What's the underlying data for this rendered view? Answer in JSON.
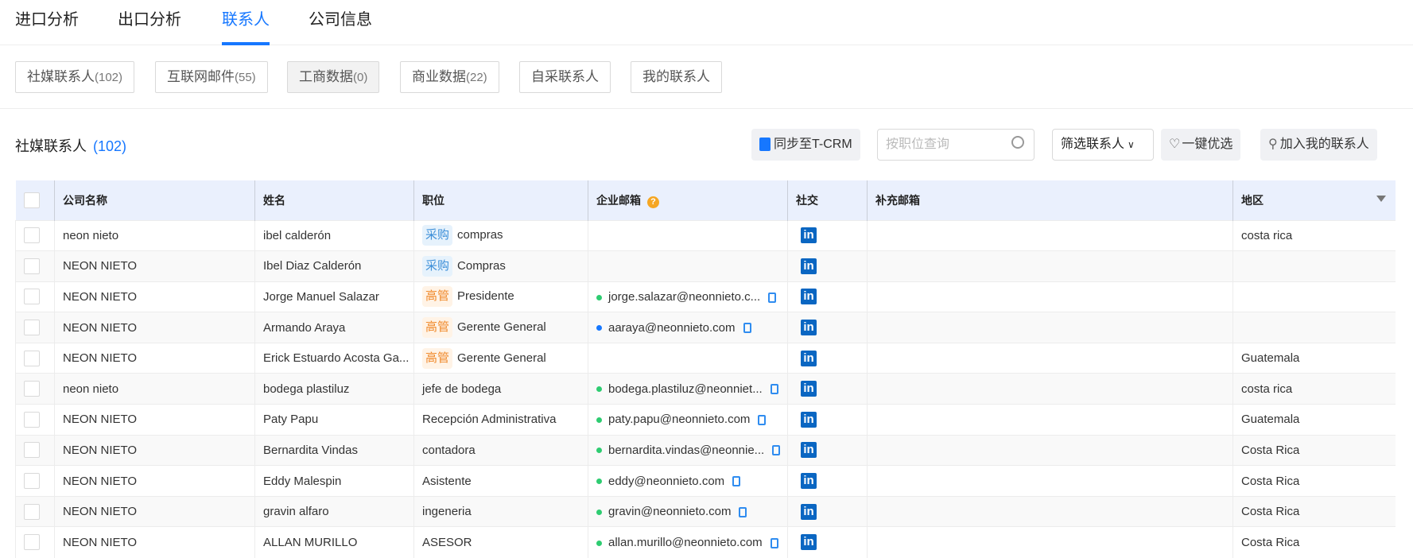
{
  "tabs": [
    "进口分析",
    "出口分析",
    "联系人",
    "公司信息"
  ],
  "active_tab": "联系人",
  "subtabs": [
    {
      "label": "社媒联系人",
      "count": "(102)"
    },
    {
      "label": "互联网邮件",
      "count": "(55)"
    },
    {
      "label": "工商数据",
      "count": "(0)"
    },
    {
      "label": "商业数据",
      "count": "(22)"
    },
    {
      "label": "自采联系人",
      "count": ""
    },
    {
      "label": "我的联系人",
      "count": ""
    }
  ],
  "section": {
    "title": "社媒联系人",
    "count": "(102)"
  },
  "toolbar": {
    "sync": "同步至T-CRM",
    "search_placeholder": "按职位查询",
    "filter": "筛选联系人",
    "optimize": "一键优选",
    "add": "加入我的联系人"
  },
  "columns": [
    "公司名称",
    "姓名",
    "职位",
    "企业邮箱",
    "社交",
    "补充邮箱",
    "地区"
  ],
  "colors": {
    "accent": "#1677ff",
    "linkedin": "#0a66c2",
    "email_verified": "#2ecc71",
    "email_other": "#1677ff"
  },
  "rows": [
    {
      "company": "neon nieto",
      "name": "ibel calderón",
      "tag": "采购",
      "tagType": "buy",
      "position": "compras",
      "email": "",
      "dot": "",
      "region": "costa rica"
    },
    {
      "company": "NEON NIETO",
      "name": "Ibel Diaz Calderón",
      "tag": "采购",
      "tagType": "buy",
      "position": "Compras",
      "email": "",
      "dot": "",
      "region": ""
    },
    {
      "company": "NEON NIETO",
      "name": "Jorge Manuel Salazar",
      "tag": "高管",
      "tagType": "exec",
      "position": "Presidente",
      "email": "jorge.salazar@neonnieto.c...",
      "dot": "green",
      "region": ""
    },
    {
      "company": "NEON NIETO",
      "name": "Armando Araya",
      "tag": "高管",
      "tagType": "exec",
      "position": "Gerente General",
      "email": "aaraya@neonnieto.com",
      "dot": "blue",
      "region": ""
    },
    {
      "company": "NEON NIETO",
      "name": "Erick Estuardo Acosta Ga...",
      "tag": "高管",
      "tagType": "exec",
      "position": "Gerente General",
      "email": "",
      "dot": "",
      "region": "Guatemala"
    },
    {
      "company": "neon nieto",
      "name": "bodega plastiluz",
      "tag": "",
      "tagType": "",
      "position": "jefe de bodega",
      "email": "bodega.plastiluz@neonniet...",
      "dot": "green",
      "region": "costa rica"
    },
    {
      "company": "NEON NIETO",
      "name": "Paty Papu",
      "tag": "",
      "tagType": "",
      "position": "Recepción Administrativa",
      "email": "paty.papu@neonnieto.com",
      "dot": "green",
      "region": "Guatemala"
    },
    {
      "company": "NEON NIETO",
      "name": "Bernardita Vindas",
      "tag": "",
      "tagType": "",
      "position": "contadora",
      "email": "bernardita.vindas@neonnie...",
      "dot": "green",
      "region": "Costa Rica"
    },
    {
      "company": "NEON NIETO",
      "name": "Eddy Malespin",
      "tag": "",
      "tagType": "",
      "position": "Asistente",
      "email": "eddy@neonnieto.com",
      "dot": "green",
      "region": "Costa Rica"
    },
    {
      "company": "NEON NIETO",
      "name": "gravin alfaro",
      "tag": "",
      "tagType": "",
      "position": "ingeneria",
      "email": "gravin@neonnieto.com",
      "dot": "green",
      "region": "Costa Rica"
    },
    {
      "company": "NEON NIETO",
      "name": "ALLAN MURILLO",
      "tag": "",
      "tagType": "",
      "position": "ASESOR",
      "email": "allan.murillo@neonnieto.com",
      "dot": "green",
      "region": "Costa Rica"
    }
  ]
}
